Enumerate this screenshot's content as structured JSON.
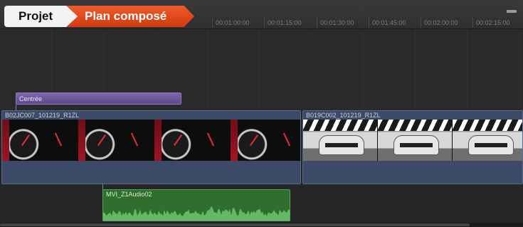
{
  "breadcrumb": {
    "project_label": "Projet",
    "current_label": "Plan composé"
  },
  "ruler": {
    "ticks": [
      "00:01:00:00",
      "00:01:15:00",
      "00:01:30:00",
      "00:01:45:00",
      "00:02:00:00",
      "00:02:15:00"
    ]
  },
  "title_clip": {
    "label": "Centrée"
  },
  "video_clips": [
    {
      "name": "B02JC007_101219_R1ZL"
    },
    {
      "name": "B019C002_101219_R1ZL"
    }
  ],
  "audio_clip": {
    "name": "MVI_Z1Audio02"
  },
  "colors": {
    "crumb_accent": "#e0461a",
    "title_clip": "#6b56a0",
    "video_clip": "#3b4a66",
    "audio_clip": "#2f6e2f"
  }
}
